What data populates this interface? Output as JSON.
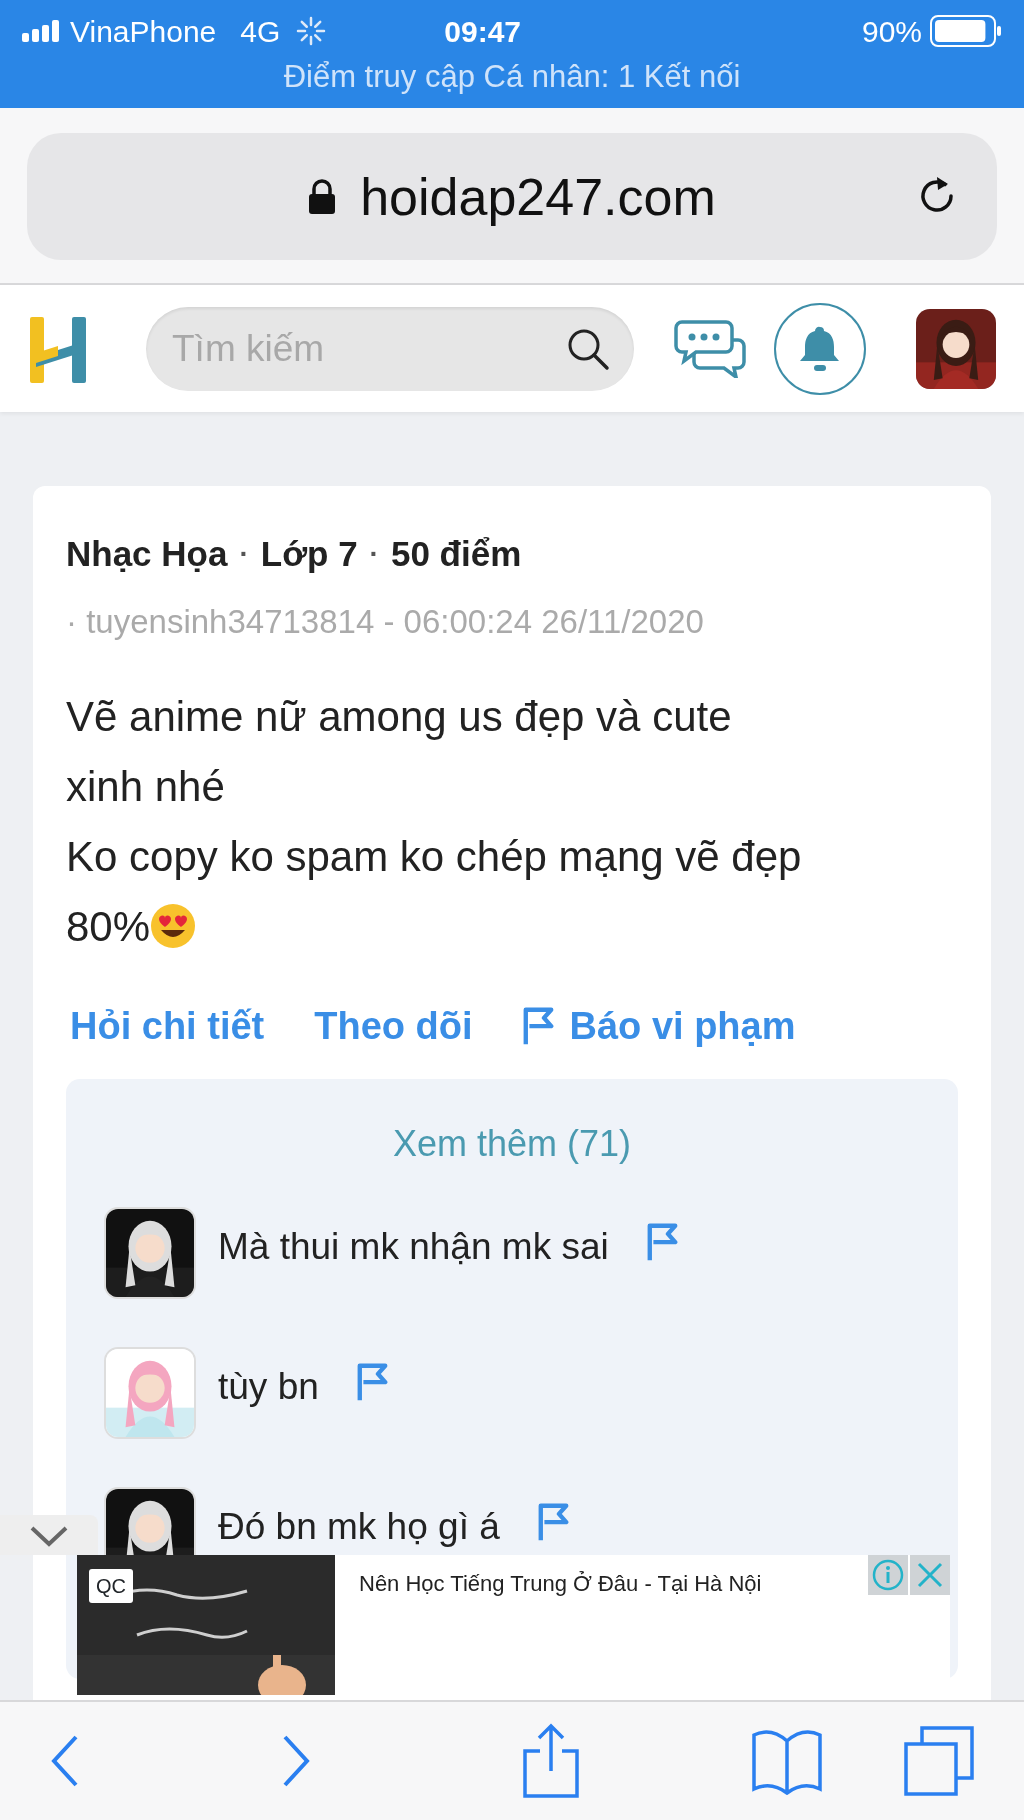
{
  "status_bar": {
    "carrier": "VinaPhone",
    "network": "4G",
    "time": "09:47",
    "battery": "90%",
    "hotspot": "Điểm truy cập Cá nhân: 1 Kết nối"
  },
  "browser": {
    "url": "hoidap247.com"
  },
  "site_header": {
    "search": {
      "placeholder": "Tìm kiếm"
    }
  },
  "question": {
    "meta": [
      "Nhạc Họa",
      "·",
      "Lớp 7",
      "·",
      "50 điểm"
    ],
    "author_time": "· tuyensinh34713814 - 06:00:24 26/11/2020",
    "body": [
      "Vẽ anime nữ among us đẹp và cute",
      "xinh nhé",
      "Ko copy ko spam ko chép mạng vẽ đẹp",
      "80%"
    ],
    "actions": [
      {
        "label": "Hỏi chi tiết",
        "kind": "plain"
      },
      {
        "label": "Theo dõi",
        "kind": "plain"
      },
      {
        "label": "Báo vi phạm",
        "kind": "flag"
      }
    ]
  },
  "comments": {
    "more": "Xem thêm (71)",
    "items": [
      {
        "text": "Mà thui mk nhận mk sai"
      },
      {
        "text": "tùy bn"
      },
      {
        "text": "Đó bn mk họ gì á"
      }
    ]
  },
  "ad": {
    "label": "QC",
    "title": "Nên Học Tiếng Trung Ở Đâu - Tại Hà Nội"
  }
}
